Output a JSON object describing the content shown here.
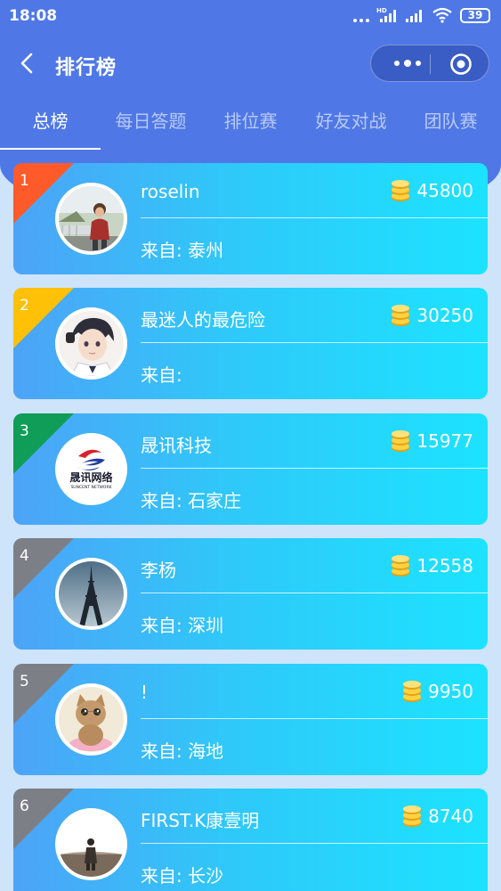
{
  "status": {
    "time": "18:08",
    "network_tag": "HD",
    "battery": "39"
  },
  "nav": {
    "title": "排行榜"
  },
  "tabs": [
    {
      "label": "总榜",
      "active": true
    },
    {
      "label": "每日答题",
      "active": false
    },
    {
      "label": "排位赛",
      "active": false
    },
    {
      "label": "好友对战",
      "active": false
    },
    {
      "label": "团队赛",
      "active": false
    }
  ],
  "ranking": [
    {
      "rank": "1",
      "name": "roselin",
      "score": "45800",
      "from": "来自: 泰州",
      "rank_color": "#ff5a2a",
      "avatar_icon": "girl-photo"
    },
    {
      "rank": "2",
      "name": "最迷人的最危险",
      "score": "30250",
      "from": "来自:",
      "rank_color": "#ffc107",
      "avatar_icon": "anime-boy"
    },
    {
      "rank": "3",
      "name": "晟讯科技",
      "score": "15977",
      "from": "来自: 石家庄",
      "rank_color": "#0f9d58",
      "avatar_icon": "shengxun-logo",
      "avatar_text": "晟讯网络",
      "avatar_subtext": "SUNCENT NETWORK"
    },
    {
      "rank": "4",
      "name": "李杨",
      "score": "12558",
      "from": "来自: 深圳",
      "rank_color": "#7d7f86",
      "avatar_icon": "eiffel-tower"
    },
    {
      "rank": "5",
      "name": "!",
      "score": "9950",
      "from": "来自: 海地",
      "rank_color": "#7d7f86",
      "avatar_icon": "kitten"
    },
    {
      "rank": "6",
      "name": "FIRST.K康壹明",
      "score": "8740",
      "from": "来自: 长沙",
      "rank_color": "#7d7f86",
      "avatar_icon": "person-field"
    }
  ]
}
